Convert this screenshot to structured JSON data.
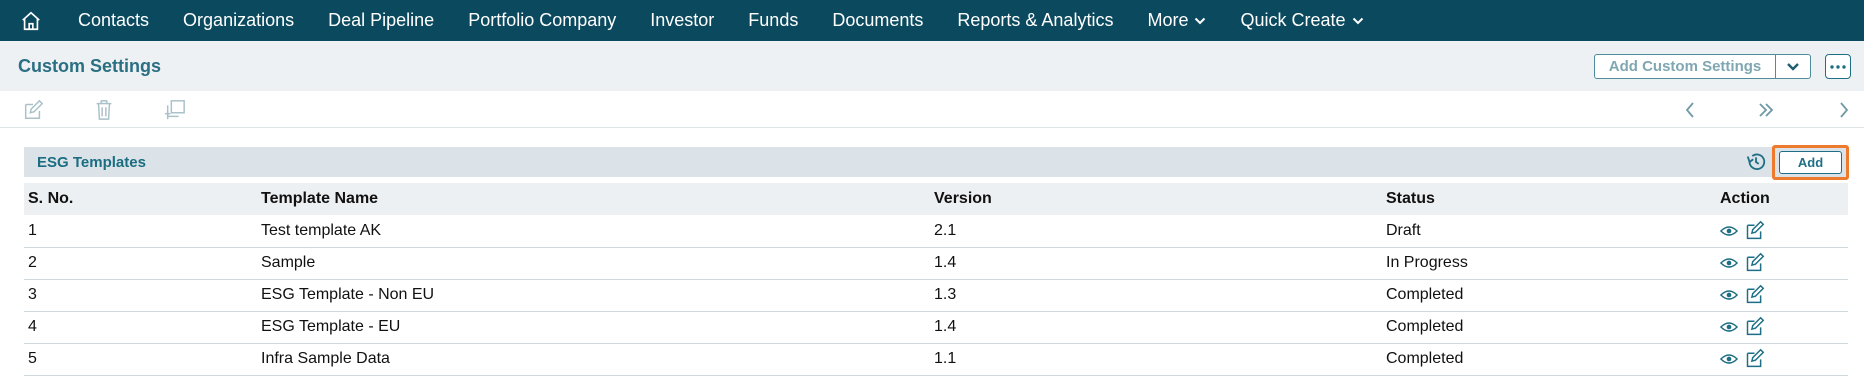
{
  "nav": {
    "items": [
      {
        "label": "Contacts",
        "dropdown": false
      },
      {
        "label": "Organizations",
        "dropdown": false
      },
      {
        "label": "Deal Pipeline",
        "dropdown": false
      },
      {
        "label": "Portfolio Company",
        "dropdown": false
      },
      {
        "label": "Investor",
        "dropdown": false
      },
      {
        "label": "Funds",
        "dropdown": false
      },
      {
        "label": "Documents",
        "dropdown": false
      },
      {
        "label": "Reports & Analytics",
        "dropdown": false
      },
      {
        "label": "More",
        "dropdown": true
      },
      {
        "label": "Quick Create",
        "dropdown": true
      }
    ]
  },
  "header": {
    "title": "Custom Settings",
    "add_custom_settings_label": "Add Custom Settings"
  },
  "panel": {
    "title": "ESG Templates",
    "add_label": "Add"
  },
  "table": {
    "columns": [
      "S. No.",
      "Template Name",
      "Version",
      "Status",
      "Action"
    ],
    "rows": [
      {
        "sno": "1",
        "name": "Test template AK",
        "version": "2.1",
        "status": "Draft"
      },
      {
        "sno": "2",
        "name": "Sample",
        "version": "1.4",
        "status": "In Progress"
      },
      {
        "sno": "3",
        "name": "ESG Template - Non EU",
        "version": "1.3",
        "status": "Completed"
      },
      {
        "sno": "4",
        "name": "ESG Template - EU",
        "version": "1.4",
        "status": "Completed"
      },
      {
        "sno": "5",
        "name": "Infra Sample Data",
        "version": "1.1",
        "status": "Completed"
      }
    ]
  },
  "colors": {
    "nav_bg": "#0b4a5e",
    "accent": "#1e6f86",
    "highlight": "#ee7a2d"
  }
}
